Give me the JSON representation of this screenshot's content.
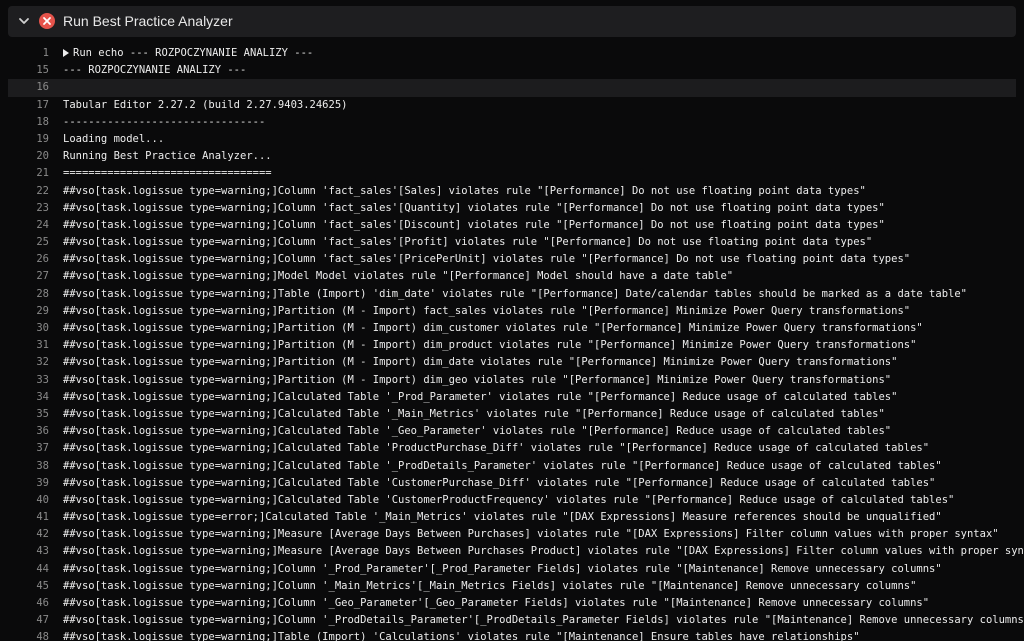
{
  "header": {
    "title": "Run Best Practice Analyzer",
    "status": "error",
    "status_color": "#e5534b",
    "expand_icon": "chevron-down-icon",
    "status_icon": "close-circle-icon"
  },
  "log": {
    "lines": [
      {
        "n": "1",
        "text": "Run echo --- ROZPOCZYNANIE ANALIZY ---",
        "collapsible": true
      },
      {
        "n": "15",
        "text": "--- ROZPOCZYNANIE ANALIZY ---"
      },
      {
        "n": "16",
        "text": "",
        "highlight": true
      },
      {
        "n": "17",
        "text": "Tabular Editor 2.27.2 (build 2.27.9403.24625)"
      },
      {
        "n": "18",
        "text": "--------------------------------"
      },
      {
        "n": "19",
        "text": "Loading model..."
      },
      {
        "n": "20",
        "text": "Running Best Practice Analyzer..."
      },
      {
        "n": "21",
        "text": "================================="
      },
      {
        "n": "22",
        "text": "##vso[task.logissue type=warning;]Column 'fact_sales'[Sales] violates rule \"[Performance] Do not use floating point data types\""
      },
      {
        "n": "23",
        "text": "##vso[task.logissue type=warning;]Column 'fact_sales'[Quantity] violates rule \"[Performance] Do not use floating point data types\""
      },
      {
        "n": "24",
        "text": "##vso[task.logissue type=warning;]Column 'fact_sales'[Discount] violates rule \"[Performance] Do not use floating point data types\""
      },
      {
        "n": "25",
        "text": "##vso[task.logissue type=warning;]Column 'fact_sales'[Profit] violates rule \"[Performance] Do not use floating point data types\""
      },
      {
        "n": "26",
        "text": "##vso[task.logissue type=warning;]Column 'fact_sales'[PricePerUnit] violates rule \"[Performance] Do not use floating point data types\""
      },
      {
        "n": "27",
        "text": "##vso[task.logissue type=warning;]Model Model violates rule \"[Performance] Model should have a date table\""
      },
      {
        "n": "28",
        "text": "##vso[task.logissue type=warning;]Table (Import) 'dim_date' violates rule \"[Performance] Date/calendar tables should be marked as a date table\""
      },
      {
        "n": "29",
        "text": "##vso[task.logissue type=warning;]Partition (M - Import) fact_sales violates rule \"[Performance] Minimize Power Query transformations\""
      },
      {
        "n": "30",
        "text": "##vso[task.logissue type=warning;]Partition (M - Import) dim_customer violates rule \"[Performance] Minimize Power Query transformations\""
      },
      {
        "n": "31",
        "text": "##vso[task.logissue type=warning;]Partition (M - Import) dim_product violates rule \"[Performance] Minimize Power Query transformations\""
      },
      {
        "n": "32",
        "text": "##vso[task.logissue type=warning;]Partition (M - Import) dim_date violates rule \"[Performance] Minimize Power Query transformations\""
      },
      {
        "n": "33",
        "text": "##vso[task.logissue type=warning;]Partition (M - Import) dim_geo violates rule \"[Performance] Minimize Power Query transformations\""
      },
      {
        "n": "34",
        "text": "##vso[task.logissue type=warning;]Calculated Table '_Prod_Parameter' violates rule \"[Performance] Reduce usage of calculated tables\""
      },
      {
        "n": "35",
        "text": "##vso[task.logissue type=warning;]Calculated Table '_Main_Metrics' violates rule \"[Performance] Reduce usage of calculated tables\""
      },
      {
        "n": "36",
        "text": "##vso[task.logissue type=warning;]Calculated Table '_Geo_Parameter' violates rule \"[Performance] Reduce usage of calculated tables\""
      },
      {
        "n": "37",
        "text": "##vso[task.logissue type=warning;]Calculated Table 'ProductPurchase_Diff' violates rule \"[Performance] Reduce usage of calculated tables\""
      },
      {
        "n": "38",
        "text": "##vso[task.logissue type=warning;]Calculated Table '_ProdDetails_Parameter' violates rule \"[Performance] Reduce usage of calculated tables\""
      },
      {
        "n": "39",
        "text": "##vso[task.logissue type=warning;]Calculated Table 'CustomerPurchase_Diff' violates rule \"[Performance] Reduce usage of calculated tables\""
      },
      {
        "n": "40",
        "text": "##vso[task.logissue type=warning;]Calculated Table 'CustomerProductFrequency' violates rule \"[Performance] Reduce usage of calculated tables\""
      },
      {
        "n": "41",
        "text": "##vso[task.logissue type=error;]Calculated Table '_Main_Metrics' violates rule \"[DAX Expressions] Measure references should be unqualified\""
      },
      {
        "n": "42",
        "text": "##vso[task.logissue type=warning;]Measure [Average Days Between Purchases] violates rule \"[DAX Expressions] Filter column values with proper syntax\""
      },
      {
        "n": "43",
        "text": "##vso[task.logissue type=warning;]Measure [Average Days Between Purchases Product] violates rule \"[DAX Expressions] Filter column values with proper syntax\""
      },
      {
        "n": "44",
        "text": "##vso[task.logissue type=warning;]Column '_Prod_Parameter'[_Prod_Parameter Fields] violates rule \"[Maintenance] Remove unnecessary columns\""
      },
      {
        "n": "45",
        "text": "##vso[task.logissue type=warning;]Column '_Main_Metrics'[_Main_Metrics Fields] violates rule \"[Maintenance] Remove unnecessary columns\""
      },
      {
        "n": "46",
        "text": "##vso[task.logissue type=warning;]Column '_Geo_Parameter'[_Geo_Parameter Fields] violates rule \"[Maintenance] Remove unnecessary columns\""
      },
      {
        "n": "47",
        "text": "##vso[task.logissue type=warning;]Column '_ProdDetails_Parameter'[_ProdDetails_Parameter Fields] violates rule \"[Maintenance] Remove unnecessary columns\""
      },
      {
        "n": "48",
        "text": "##vso[task.logissue type=warning;]Table (Import) 'Calculations' violates rule \"[Maintenance] Ensure tables have relationships\""
      }
    ]
  }
}
